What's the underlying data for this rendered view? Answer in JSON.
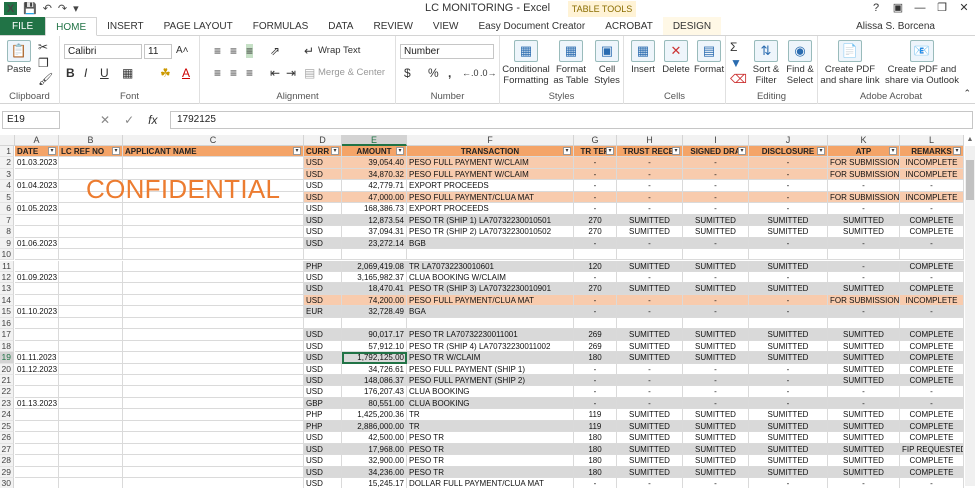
{
  "title": "LC MONITORING - Excel",
  "table_tools": "TABLE TOOLS",
  "user": "Alissa S. Borcena",
  "qat_icons": [
    "excel-logo",
    "save-icon",
    "undo-icon",
    "redo-icon"
  ],
  "tabs": [
    "FILE",
    "HOME",
    "INSERT",
    "PAGE LAYOUT",
    "FORMULAS",
    "DATA",
    "REVIEW",
    "VIEW",
    "Easy Document Creator",
    "ACROBAT",
    "DESIGN"
  ],
  "ribbon": {
    "clipboard": {
      "label": "Clipboard",
      "paste": "Paste"
    },
    "font": {
      "label": "Font",
      "name": "Calibri",
      "size": "11"
    },
    "alignment": {
      "label": "Alignment",
      "wrap": "Wrap Text",
      "merge": "Merge & Center"
    },
    "number": {
      "label": "Number",
      "format": "Number",
      "currency": "$",
      "percent": "%",
      "comma": ","
    },
    "styles": {
      "label": "Styles",
      "cond": "Conditional Formatting",
      "fmt_table": "Format as Table",
      "cell_styles": "Cell Styles"
    },
    "cells": {
      "label": "Cells",
      "insert": "Insert",
      "delete": "Delete",
      "format": "Format"
    },
    "editing": {
      "label": "Editing",
      "sort": "Sort & Filter",
      "find": "Find & Select"
    },
    "acrobat": {
      "label": "Adobe Acrobat",
      "create_pdf": "Create PDF and share link",
      "create_pdf_outlook": "Create PDF and share via Outlook"
    }
  },
  "formula_bar": {
    "namebox": "E19",
    "fx": "fx",
    "value": "1792125"
  },
  "columns": [
    "A",
    "B",
    "C",
    "D",
    "E",
    "F",
    "G",
    "H",
    "I",
    "J",
    "K",
    "L"
  ],
  "headers": [
    "DATE",
    "LC REF NO",
    "APPLICANT NAME",
    "CURR",
    "AMOUNT",
    "TRANSACTION",
    "TR TER",
    "TRUST RECEI",
    "SIGNED DRA",
    "DISCLOSURE",
    "ATP",
    "REMARKS"
  ],
  "watermark": "CONFIDENTIAL",
  "rows": [
    {
      "n": "2",
      "hl": true,
      "c": [
        "01.03.2023",
        "",
        "",
        "USD",
        "39,054.40",
        "PESO FULL PAYMENT W/CLAIM",
        "-",
        "-",
        "-",
        "-",
        "FOR SUBMISSION",
        "INCOMPLETE"
      ]
    },
    {
      "n": "3",
      "hl": true,
      "c": [
        "",
        "",
        "",
        "USD",
        "34,870.32",
        "PESO FULL PAYMENT W/CLAIM",
        "-",
        "-",
        "-",
        "-",
        "FOR SUBMISSION",
        "INCOMPLETE"
      ]
    },
    {
      "n": "4",
      "hl": false,
      "c": [
        "01.04.2023",
        "",
        "",
        "USD",
        "42,779.71",
        "EXPORT PROCEEDS",
        "-",
        "-",
        "-",
        "-",
        "-",
        "-"
      ]
    },
    {
      "n": "5",
      "hl": true,
      "c": [
        "",
        "",
        "",
        "USD",
        "47,000.00",
        "PESO FULL PAYMENT/CLUA MAT",
        "-",
        "-",
        "-",
        "-",
        "FOR SUBMISSION",
        "INCOMPLETE"
      ]
    },
    {
      "n": "6",
      "hl": false,
      "c": [
        "01.05.2023",
        "",
        "",
        "USD",
        "168,386.73",
        "EXPORT PROCEEDS",
        "-",
        "-",
        "-",
        "-",
        "-",
        "-"
      ]
    },
    {
      "n": "7",
      "hl": false,
      "c": [
        "",
        "",
        "",
        "USD",
        "12,873.54",
        "PESO TR (SHIP 1) LA70732230010501",
        "270",
        "SUMITTED",
        "SUMITTED",
        "SUMITTED",
        "SUMITTED",
        "COMPLETE"
      ]
    },
    {
      "n": "8",
      "hl": false,
      "c": [
        "",
        "",
        "",
        "USD",
        "37,094.31",
        "PESO TR (SHIP 2) LA70732230010502",
        "270",
        "SUMITTED",
        "SUMITTED",
        "SUMITTED",
        "SUMITTED",
        "COMPLETE"
      ]
    },
    {
      "n": "9",
      "hl": false,
      "c": [
        "01.06.2023",
        "",
        "",
        "USD",
        "23,272.14",
        "BGB",
        "-",
        "-",
        "-",
        "-",
        "-",
        "-"
      ]
    },
    {
      "n": "10",
      "hl": false,
      "c": [
        "",
        "",
        "",
        "",
        "",
        "",
        "",
        "",
        "",
        "",
        "",
        ""
      ]
    },
    {
      "n": "11",
      "hl": false,
      "c": [
        "",
        "",
        "",
        "PHP",
        "2,069,419.08",
        "TR LA70732230010601",
        "120",
        "SUMITTED",
        "SUMITTED",
        "SUMITTED",
        "-",
        "COMPLETE"
      ]
    },
    {
      "n": "12",
      "hl": false,
      "c": [
        "01.09.2023",
        "",
        "",
        "USD",
        "3,165,982.37",
        "CLUA BOOKING W/CLAIM",
        "-",
        "-",
        "-",
        "-",
        "-",
        "-"
      ]
    },
    {
      "n": "13",
      "hl": false,
      "c": [
        "",
        "",
        "",
        "USD",
        "18,470.41",
        "PESO TR (SHIP 3) LA70732230010901",
        "270",
        "SUMITTED",
        "SUMITTED",
        "SUMITTED",
        "SUMITTED",
        "COMPLETE"
      ]
    },
    {
      "n": "14",
      "hl": true,
      "c": [
        "",
        "",
        "",
        "USD",
        "74,200.00",
        "PESO FULL PAYMENT/CLUA MAT",
        "-",
        "-",
        "-",
        "-",
        "FOR SUBMISSION",
        "INCOMPLETE"
      ]
    },
    {
      "n": "15",
      "hl": false,
      "c": [
        "01.10.2023",
        "",
        "",
        "EUR",
        "32,728.49",
        "BGA",
        "-",
        "-",
        "-",
        "-",
        "-",
        "-"
      ]
    },
    {
      "n": "16",
      "hl": false,
      "c": [
        "",
        "",
        "",
        "",
        "",
        "",
        "",
        "",
        "",
        "",
        "",
        ""
      ]
    },
    {
      "n": "17",
      "hl": false,
      "c": [
        "",
        "",
        "",
        "USD",
        "90,017.17",
        "PESO TR LA70732230011001",
        "269",
        "SUMITTED",
        "SUMITTED",
        "SUMITTED",
        "SUMITTED",
        "COMPLETE"
      ]
    },
    {
      "n": "18",
      "hl": false,
      "c": [
        "",
        "",
        "",
        "USD",
        "57,912.10",
        "PESO TR (SHIP 4) LA70732230011002",
        "269",
        "SUMITTED",
        "SUMITTED",
        "SUMITTED",
        "SUMITTED",
        "COMPLETE"
      ]
    },
    {
      "n": "19",
      "hl": false,
      "sel": true,
      "c": [
        "01.11.2023",
        "",
        "",
        "USD",
        "1,792,125.00",
        "PESO TR W/CLAIM",
        "180",
        "SUMITTED",
        "SUMITTED",
        "SUMITTED",
        "SUMITTED",
        "COMPLETE"
      ]
    },
    {
      "n": "20",
      "hl": false,
      "c": [
        "01.12.2023",
        "",
        "",
        "USD",
        "34,726.61",
        "PESO FULL PAYMENT (SHIP 1)",
        "-",
        "-",
        "-",
        "-",
        "SUMITTED",
        "COMPLETE"
      ]
    },
    {
      "n": "21",
      "hl": false,
      "c": [
        "",
        "",
        "",
        "USD",
        "148,086.37",
        "PESO FULL PAYMENT (SHIP 2)",
        "-",
        "-",
        "-",
        "-",
        "SUMITTED",
        "COMPLETE"
      ]
    },
    {
      "n": "22",
      "hl": false,
      "c": [
        "",
        "",
        "",
        "USD",
        "176,207.43",
        "CLUA BOOKING",
        "-",
        "-",
        "-",
        "-",
        "-",
        "-"
      ]
    },
    {
      "n": "23",
      "hl": false,
      "c": [
        "01.13.2023",
        "",
        "",
        "GBP",
        "80,551.00",
        "CLUA BOOKING",
        "-",
        "-",
        "-",
        "-",
        "-",
        "-"
      ]
    },
    {
      "n": "24",
      "hl": false,
      "c": [
        "",
        "",
        "",
        "PHP",
        "1,425,200.36",
        "TR",
        "119",
        "SUMITTED",
        "SUMITTED",
        "SUMITTED",
        "SUMITTED",
        "COMPLETE"
      ]
    },
    {
      "n": "25",
      "hl": false,
      "c": [
        "",
        "",
        "",
        "PHP",
        "2,886,000.00",
        "TR",
        "119",
        "SUMITTED",
        "SUMITTED",
        "SUMITTED",
        "SUMITTED",
        "COMPLETE"
      ]
    },
    {
      "n": "26",
      "hl": false,
      "c": [
        "",
        "",
        "",
        "USD",
        "42,500.00",
        "PESO TR",
        "180",
        "SUMITTED",
        "SUMITTED",
        "SUMITTED",
        "SUMITTED",
        "COMPLETE"
      ]
    },
    {
      "n": "27",
      "hl": false,
      "c": [
        "",
        "",
        "",
        "USD",
        "17,968.00",
        "PESO TR",
        "180",
        "SUMITTED",
        "SUMITTED",
        "SUMITTED",
        "SUMITTED",
        "FIP REQUESTED"
      ]
    },
    {
      "n": "28",
      "hl": false,
      "c": [
        "",
        "",
        "",
        "USD",
        "32,900.00",
        "PESO TR",
        "180",
        "SUMITTED",
        "SUMITTED",
        "SUMITTED",
        "SUMITTED",
        "COMPLETE"
      ]
    },
    {
      "n": "29",
      "hl": false,
      "c": [
        "",
        "",
        "",
        "USD",
        "34,236.00",
        "PESO TR",
        "180",
        "SUMITTED",
        "SUMITTED",
        "SUMITTED",
        "SUMITTED",
        "COMPLETE"
      ]
    },
    {
      "n": "30",
      "hl": false,
      "c": [
        "",
        "",
        "",
        "USD",
        "15,245.17",
        "DOLLAR FULL PAYMENT/CLUA MAT",
        "-",
        "-",
        "-",
        "-",
        "-",
        "-"
      ]
    }
  ]
}
